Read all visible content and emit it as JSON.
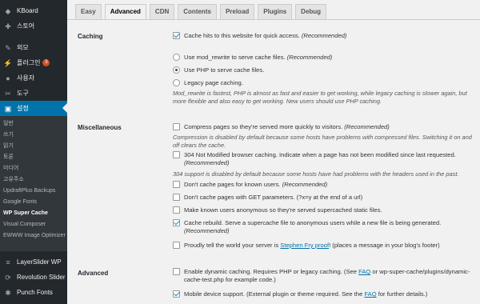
{
  "sidebar": {
    "items": [
      {
        "label": "KBoard",
        "icon": "kboard-icon"
      },
      {
        "label": "스토어",
        "icon": "store-icon"
      },
      {
        "label": "외모",
        "icon": "appearance-icon"
      },
      {
        "label": "플러그인",
        "icon": "plugins-icon",
        "badge": "3"
      },
      {
        "label": "사용자",
        "icon": "users-icon"
      },
      {
        "label": "도구",
        "icon": "tools-icon"
      },
      {
        "label": "설정",
        "icon": "settings-icon"
      }
    ],
    "submenu": [
      "일반",
      "쓰기",
      "읽기",
      "토론",
      "미디어",
      "고유주소",
      "UpdraftPlus Backups",
      "Google Fonts",
      "WP Super Cache",
      "Visual Composer",
      "EWWW Image Optimizer"
    ],
    "bottom_items": [
      {
        "label": "LayerSlider WP",
        "icon": "layerslider-icon"
      },
      {
        "label": "Revolution Slider",
        "icon": "revolution-slider-icon"
      },
      {
        "label": "Punch Fonts",
        "icon": "punch-fonts-icon"
      }
    ]
  },
  "tabs": [
    "Easy",
    "Advanced",
    "CDN",
    "Contents",
    "Preload",
    "Plugins",
    "Debug"
  ],
  "active_tab": "Advanced",
  "caching": {
    "label": "Caching",
    "cache_hits": {
      "text": "Cache hits to this website for quick access.",
      "rec": "(Recommended)",
      "checked": true
    },
    "mod_rewrite": {
      "text": "Use mod_rewrite to serve cache files.",
      "rec": "(Recommended)",
      "checked": false
    },
    "use_php": {
      "text": "Use PHP to serve cache files.",
      "checked": true
    },
    "legacy": {
      "text": "Legacy page caching.",
      "checked": false
    },
    "note": "Mod_rewrite is fastest, PHP is almost as fast and easier to get working, while legacy caching is slower again, but more flexible and also easy to get working. New users should use PHP caching."
  },
  "misc": {
    "label": "Miscellaneous",
    "compress": {
      "text": "Compress pages so they're served more quickly to visitors.",
      "rec": "(Recommended)",
      "checked": false
    },
    "compress_note": "Compression is disabled by default because some hosts have problems with compressed files. Switching it on and off clears the cache.",
    "not_modified": {
      "text": "304 Not Modified browser caching. Indicate when a page has not been modified since last requested.",
      "rec": "(Recommended)",
      "checked": false
    },
    "not_modified_note": "304 support is disabled by default because some hosts have had problems with the headers used in the past.",
    "known_users": {
      "text": "Don't cache pages for known users.",
      "rec": "(Recommended)",
      "checked": false
    },
    "get_params": {
      "text": "Don't cache pages with GET parameters. (?x=y at the end of a url)",
      "checked": false
    },
    "anonymous": {
      "text": "Make known users anonymous so they're served supercached static files.",
      "checked": false
    },
    "rebuild": {
      "text": "Cache rebuild. Serve a supercache file to anonymous users while a new file is being generated.",
      "rec": "(Recommended)",
      "checked": true
    },
    "proudly": {
      "pre": "Proudly tell the world your server is ",
      "link": "Stephen Fry proof",
      "post": "! (places a message in your blog's footer)",
      "checked": false
    }
  },
  "advanced": {
    "label": "Advanced",
    "dynamic": {
      "pre": "Enable dynamic caching. Requires PHP or legacy caching. (See ",
      "link": "FAQ",
      "post": " or wp-super-cache/plugins/dynamic-cache-test.php for example code.)",
      "checked": false
    },
    "mobile": {
      "pre": "Mobile device support. (External plugin or theme required. See the ",
      "link": "FAQ",
      "post": " for further details.)",
      "checked": true
    }
  }
}
